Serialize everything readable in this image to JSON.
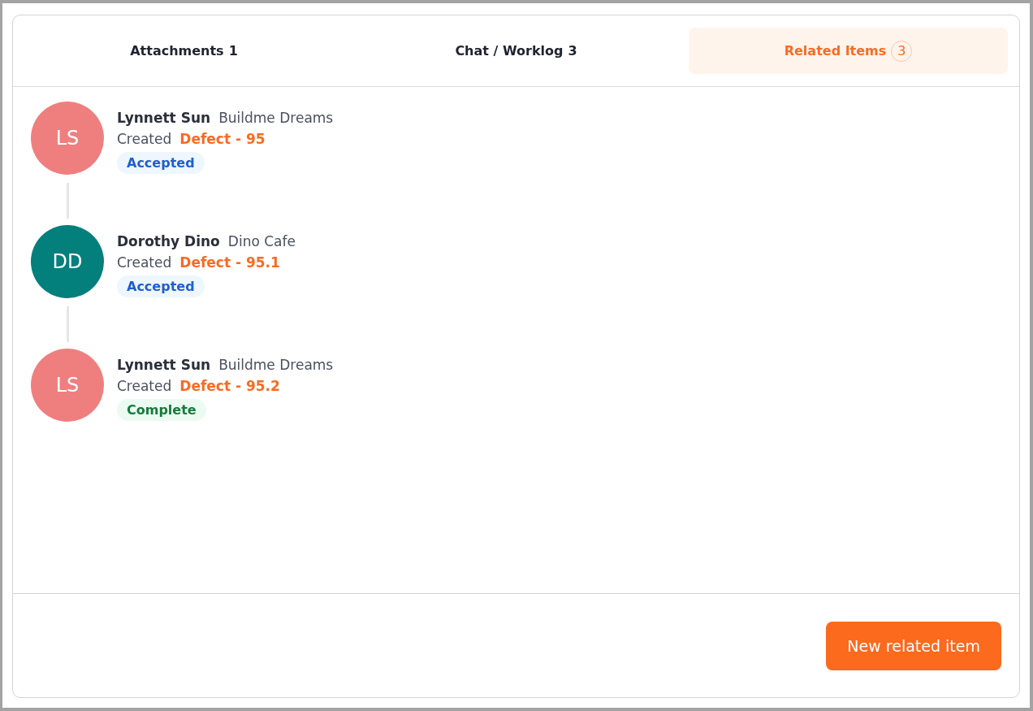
{
  "tabs": [
    {
      "label": "Attachments",
      "count": "1",
      "selected": false
    },
    {
      "label": "Chat / Worklog",
      "count": "3",
      "selected": false
    },
    {
      "label": "Related Items",
      "count": "3",
      "selected": true
    }
  ],
  "items": [
    {
      "initials": "LS",
      "color": "#ef7f7f",
      "name": "Lynnett Sun",
      "company": "Buildme Dreams",
      "action": "Created",
      "link": "Defect - 95",
      "status": {
        "kind": "accepted",
        "label": "Accepted"
      }
    },
    {
      "initials": "DD",
      "color": "#037f7c",
      "name": "Dorothy Dino",
      "company": "Dino Cafe",
      "action": "Created",
      "link": "Defect - 95.1",
      "status": {
        "kind": "accepted",
        "label": "Accepted"
      }
    },
    {
      "initials": "LS",
      "color": "#ef7f7f",
      "name": "Lynnett Sun",
      "company": "Buildme Dreams",
      "action": "Created",
      "link": "Defect - 95.2",
      "status": {
        "kind": "complete",
        "label": "Complete"
      }
    }
  ],
  "footer": {
    "button": "New related item"
  }
}
